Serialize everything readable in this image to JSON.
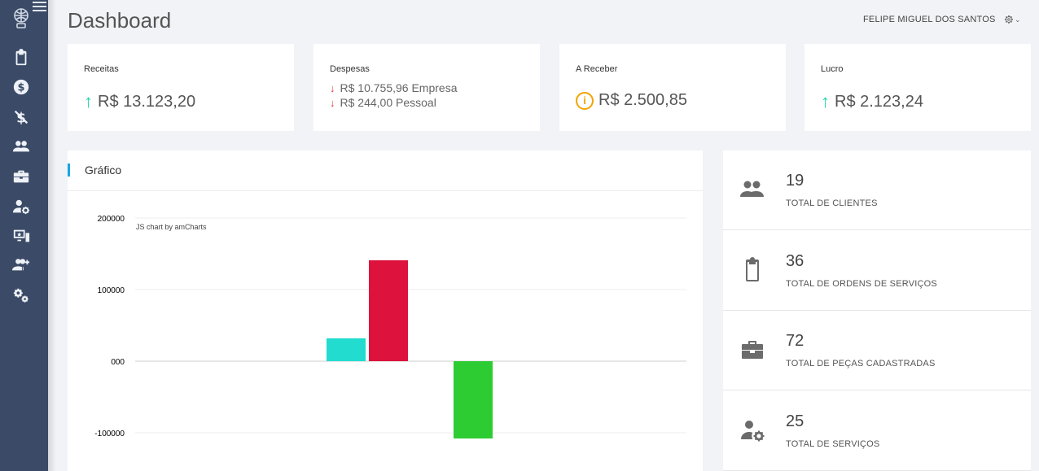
{
  "header": {
    "title": "Dashboard",
    "user_name": "FELIPE MIGUEL DOS SANTOS",
    "settings_icon": "gear-icon"
  },
  "sidebar": {
    "items": [
      {
        "icon": "clipboard-icon"
      },
      {
        "icon": "dollar-circle-icon"
      },
      {
        "icon": "no-dollar-icon"
      },
      {
        "icon": "people-icon"
      },
      {
        "icon": "toolbox-icon"
      },
      {
        "icon": "user-gear-icon"
      },
      {
        "icon": "monitor-star-icon"
      },
      {
        "icon": "user-plus-icon"
      },
      {
        "icon": "gears-icon"
      }
    ]
  },
  "stats": {
    "receitas": {
      "label": "Receitas",
      "value": "R$ 13.123,20"
    },
    "despesas": {
      "label": "Despesas",
      "empresa": "R$ 10.755,96 Empresa",
      "pessoal": "R$ 244,00 Pessoal"
    },
    "a_receber": {
      "label": "A Receber",
      "value": "R$ 2.500,85"
    },
    "lucro": {
      "label": "Lucro",
      "value": "R$ 2.123,24"
    }
  },
  "chart_panel": {
    "title": "Gráfico",
    "credit": "JS chart by amCharts"
  },
  "chart_data": {
    "type": "bar",
    "title": "",
    "y_ticks": [
      "200000",
      "100000",
      "000",
      "-100000"
    ],
    "ylim": [
      -130000,
      200000
    ],
    "bars": [
      {
        "value": 32000,
        "color": "#22dccf"
      },
      {
        "value": 141000,
        "color": "#dd123d"
      },
      {
        "value": -108000,
        "color": "#2ecc33"
      }
    ],
    "grid": true
  },
  "totals": [
    {
      "number": "19",
      "label": "TOTAL DE CLIENTES",
      "icon": "people-icon"
    },
    {
      "number": "36",
      "label": "TOTAL DE ORDENS DE SERVIÇOS",
      "icon": "clipboard-icon"
    },
    {
      "number": "72",
      "label": "TOTAL DE PEÇAS CADASTRADAS",
      "icon": "toolbox-icon"
    },
    {
      "number": "25",
      "label": "TOTAL DE SERVIÇOS",
      "icon": "user-gear-icon"
    }
  ]
}
